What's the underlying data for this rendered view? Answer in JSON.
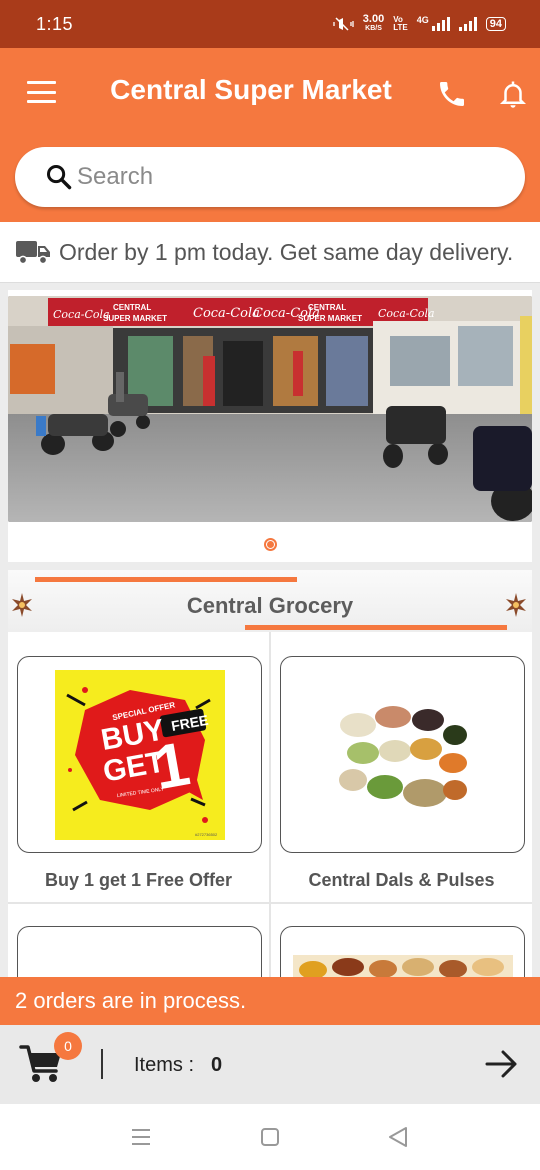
{
  "status_bar": {
    "time": "1:15",
    "net_speed": "3.00",
    "net_unit": "KB/S",
    "volte": "Vo\nLTE",
    "network": "4G",
    "battery": "94"
  },
  "header": {
    "title": "Central Super Market",
    "icons": [
      "menu-icon",
      "phone-icon",
      "bell-icon"
    ]
  },
  "search": {
    "placeholder": "Search",
    "value": ""
  },
  "delivery_notice": {
    "text": "Order by 1 pm today. Get same day delivery.",
    "icon": "truck-icon"
  },
  "banner": {
    "store_sign": "CENTRAL SUPER MARKET",
    "sponsor_text": "Coca-Cola",
    "slides_count": 1,
    "active_slide": 1
  },
  "section": {
    "title": "Central Grocery"
  },
  "categories": [
    {
      "label": "Buy 1 get 1 Free Offer",
      "image": {
        "special": "SPECIAL OFFER",
        "buy": "BUY",
        "one": "1",
        "get": "GET",
        "free": "FREE",
        "limited": "LIMITED TIME ONLY",
        "code": "#272736502"
      }
    },
    {
      "label": "Central Dals & Pulses"
    },
    {
      "label": ""
    },
    {
      "label": ""
    }
  ],
  "orders_bar": {
    "text": "2 orders are in process."
  },
  "cart": {
    "badge": "0",
    "items_label": "Items :",
    "items_count": "0"
  },
  "colors": {
    "accent": "#f5783f",
    "status_bar": "#a93b1a"
  }
}
